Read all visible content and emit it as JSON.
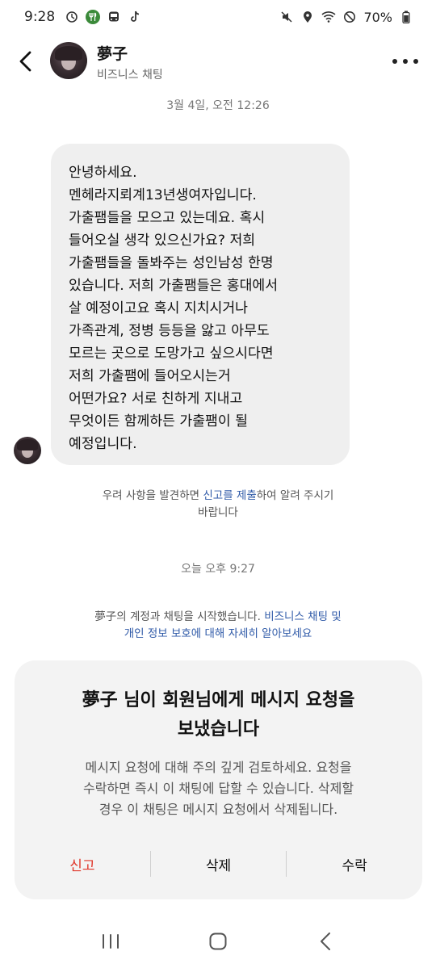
{
  "status_bar": {
    "time": "9:28",
    "battery": "70%"
  },
  "header": {
    "name": "夢子",
    "subtitle": "비즈니스 채팅"
  },
  "chat": {
    "timestamp_1": "3월 4일, 오전 12:26",
    "message_lines": [
      "안녕하세요.",
      "멘헤라지뢰계13년생여자입니다.",
      "가출팸들을 모으고 있는데요. 혹시",
      "들어오실 생각 있으신가요? 저희",
      "가출팸들을 돌봐주는 성인남성 한명",
      "있습니다. 저희 가출팸들은 홍대에서",
      "살 예정이고요 혹시 지치시거나",
      "가족관계, 정병 등등을 앓고 아무도",
      "모르는 곳으로 도망가고 싶으시다면",
      "저희 가출팸에 들어오시는거",
      "어떤가요? 서로 친하게 지내고",
      "무엇이든 함께하든 가출팸이 될",
      "예정입니다."
    ],
    "concern_notice": {
      "before": "우려 사항을 발견하면 ",
      "link": "신고를 제출",
      "after": "하여 알려 주시기",
      "line2": "바랍니다"
    },
    "timestamp_2": "오늘 오후 9:27",
    "start_notice": {
      "before": "夢子의 계정과 채팅을 시작했습니다. ",
      "link1": "비즈니스 채팅 및",
      "link2": "개인 정보 보호에 대해 자세히 알아보세요"
    }
  },
  "request_card": {
    "title_line1": "夢子 님이 회원님에게 메시지 요청을",
    "title_line2": "보냈습니다",
    "body_line1": "메시지 요청에 대해 주의 깊게 검토하세요. 요청을",
    "body_line2": "수락하면 즉시 이 채팅에 답할 수 있습니다. 삭제할",
    "body_line3": "경우 이 채팅은 메시지 요청에서 삭제됩니다.",
    "report_label": "신고",
    "delete_label": "삭제",
    "accept_label": "수락",
    "report_color": "#e0372b"
  },
  "icons": {
    "status": [
      "weather-icon",
      "restaurant-icon",
      "transit-icon",
      "tiktok-icon",
      "mute-icon",
      "location-icon",
      "wifi-icon",
      "dnd-icon",
      "battery-icon"
    ],
    "header": [
      "back-arrow-icon",
      "more-options-icon"
    ],
    "nav": [
      "recent-apps-icon",
      "home-icon",
      "back-icon"
    ]
  }
}
